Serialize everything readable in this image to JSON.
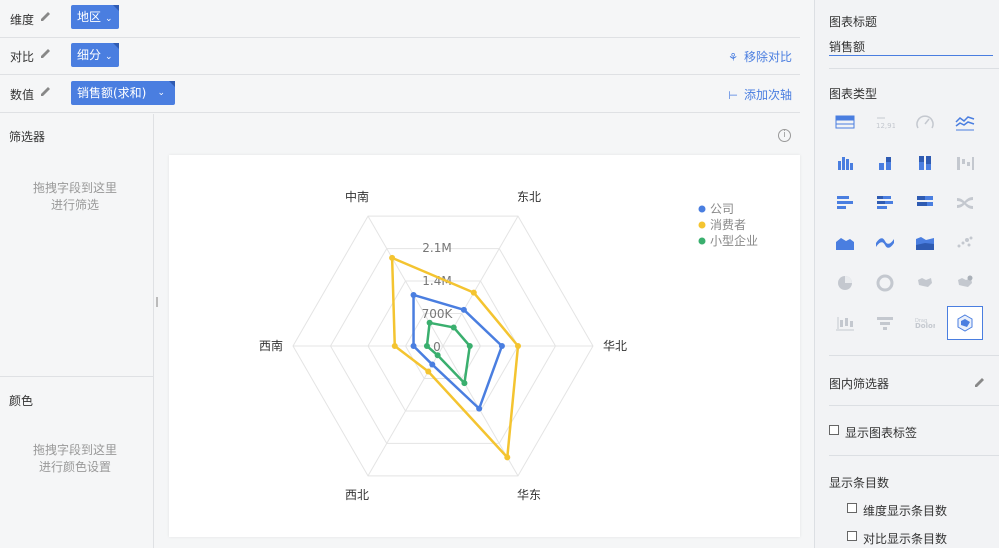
{
  "shelves": {
    "dimension": {
      "label": "维度",
      "pill": "地区"
    },
    "compare": {
      "label": "对比",
      "pill": "细分",
      "action": "移除对比"
    },
    "value": {
      "label": "数值",
      "pill": "销售额(求和)",
      "action": "添加次轴"
    }
  },
  "filter": {
    "title": "筛选器",
    "hint_line1": "拖拽字段到这里",
    "hint_line2": "进行筛选"
  },
  "color": {
    "title": "颜色",
    "hint_line1": "拖拽字段到这里",
    "hint_line2": "进行颜色设置"
  },
  "right_panel": {
    "chart_title_label": "图表标题",
    "chart_title_value": "销售额",
    "chart_type_label": "图表类型",
    "inner_filter_label": "图内筛选器",
    "show_labels": "显示图表标签",
    "show_count_title": "显示条目数",
    "dim_count": "维度显示条目数",
    "cmp_count": "对比显示条目数",
    "chart_types": [
      "table-icon",
      "kpi-icon",
      "gauge-icon",
      "line-icon",
      "bar-icon",
      "stacked-bar-icon",
      "percent-bar-icon",
      "waterfall-icon",
      "hbar-icon",
      "stacked-hbar-icon",
      "percent-hbar-icon",
      "sankey-icon",
      "area-icon",
      "stream-icon",
      "stacked-area-icon",
      "scatter-icon",
      "pie-icon",
      "donut-icon",
      "map-icon",
      "bubble-map-icon",
      "boxplot-icon",
      "funnel-icon",
      "wordcloud-icon",
      "radar-icon"
    ]
  },
  "chart_data": {
    "type": "radar",
    "categories": [
      "中南",
      "东北",
      "华北",
      "华东",
      "西北",
      "西南"
    ],
    "ticks": [
      "0",
      "700K",
      "1.4M",
      "2.1M"
    ],
    "rmax": 2800000,
    "series": [
      {
        "name": "公司",
        "color": "#4a7ee0",
        "values": [
          1100000,
          780000,
          1100000,
          1350000,
          400000,
          550000
        ]
      },
      {
        "name": "消费者",
        "color": "#f4c430",
        "values": [
          1900000,
          1150000,
          1400000,
          2400000,
          550000,
          900000
        ]
      },
      {
        "name": "小型企业",
        "color": "#3aaf6e",
        "values": [
          500000,
          400000,
          500000,
          800000,
          200000,
          300000
        ]
      }
    ]
  }
}
